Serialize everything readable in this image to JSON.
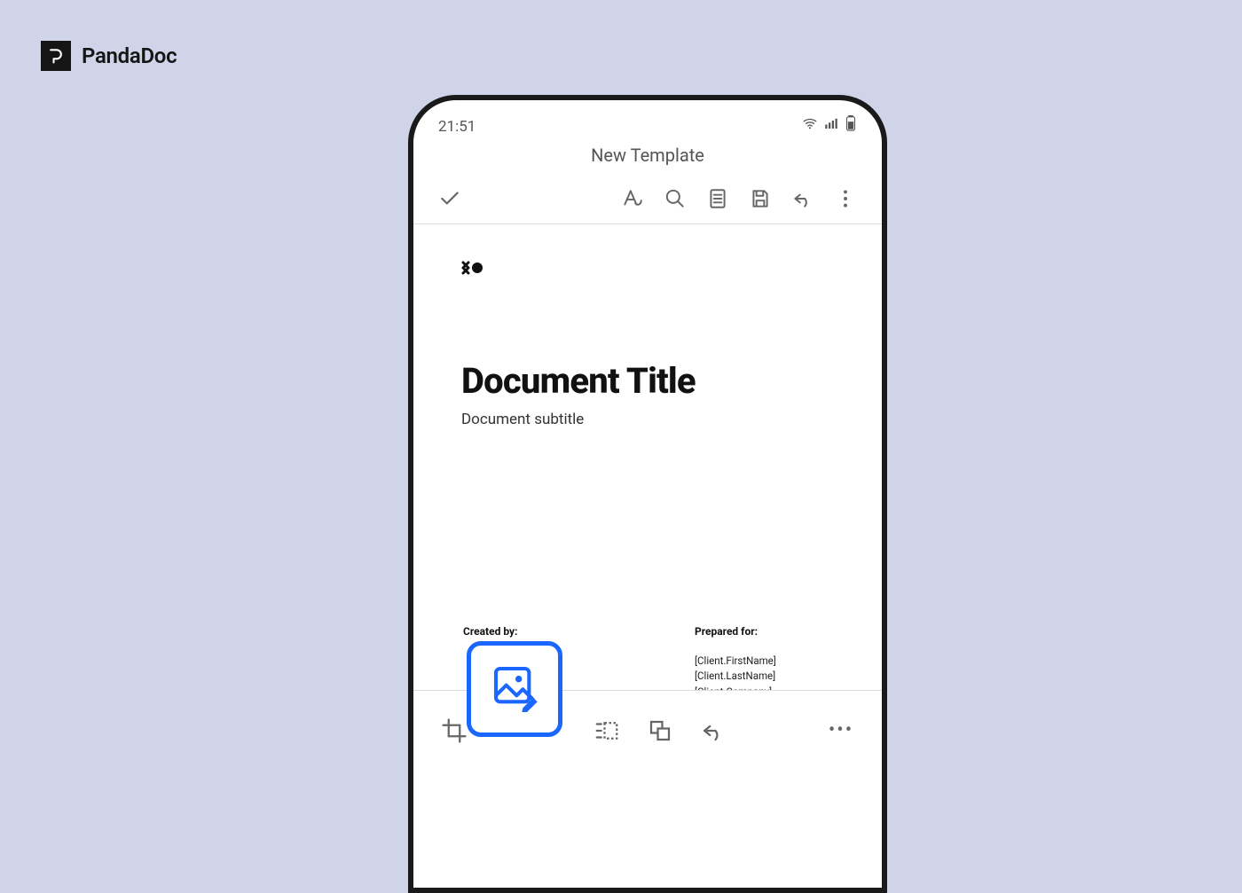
{
  "brand": {
    "name": "PandaDoc"
  },
  "status": {
    "time": "21:51"
  },
  "screen": {
    "title": "New Template"
  },
  "document": {
    "logo_glyph": "✖●",
    "title": "Document Title",
    "subtitle": "Document subtitle",
    "created_by_label": "Created by:",
    "prepared_for_label": "Prepared for:",
    "prepared_for_line1": "[Client.FirstName] [Client.LastName]",
    "prepared_for_line2": "[Client.Company]"
  },
  "bottom": {
    "more": "•••"
  }
}
